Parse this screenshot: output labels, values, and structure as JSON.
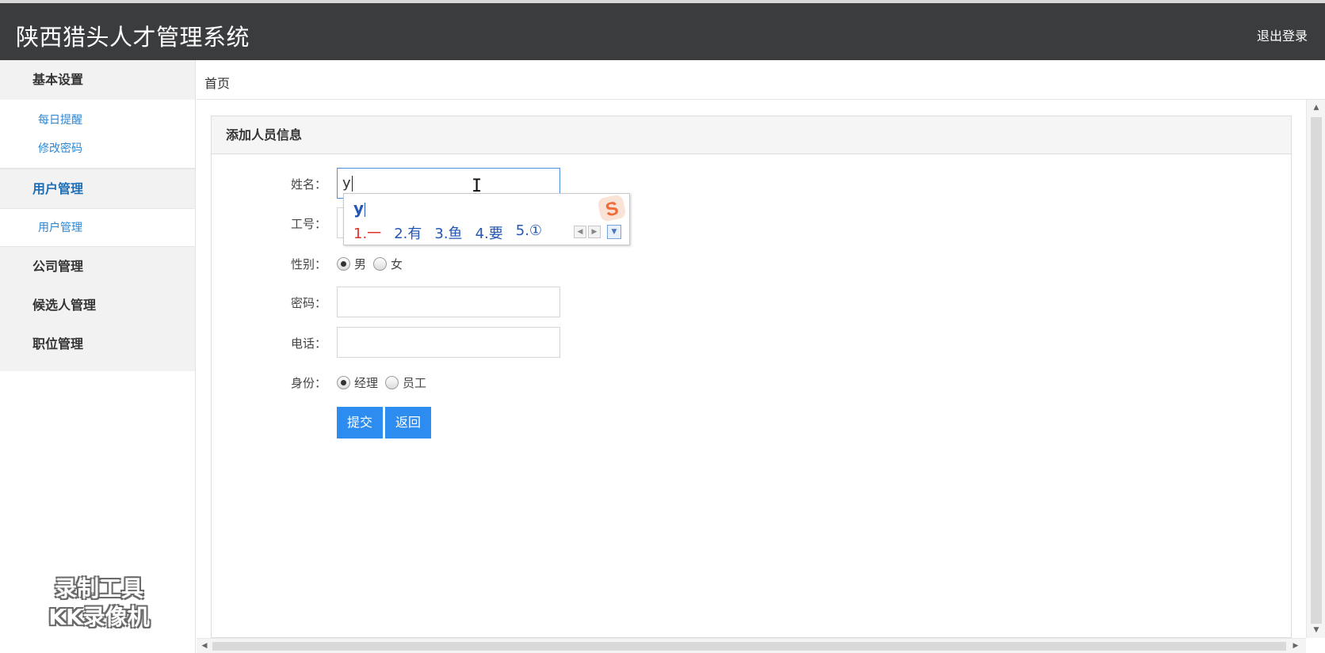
{
  "header": {
    "title": "陕西猎头人才管理系统",
    "logout": "退出登录"
  },
  "sidebar": {
    "groups": [
      {
        "label": "基本设置",
        "items": [
          "每日提醒",
          "修改密码"
        ]
      },
      {
        "label": "用户管理",
        "items": [
          "用户管理"
        ]
      },
      {
        "label": "公司管理",
        "items": []
      },
      {
        "label": "候选人管理",
        "items": []
      },
      {
        "label": "职位管理",
        "items": []
      }
    ]
  },
  "watermark": {
    "line1": "录制工具",
    "line2": "KK录像机"
  },
  "breadcrumb": "首页",
  "panel": {
    "title": "添加人员信息"
  },
  "form": {
    "name": {
      "label": "姓名：",
      "value": "y"
    },
    "job_no": {
      "label": "工号：",
      "value": ""
    },
    "gender": {
      "label": "性别：",
      "options": [
        "男",
        "女"
      ],
      "selected": "男"
    },
    "password": {
      "label": "密码：",
      "value": ""
    },
    "phone": {
      "label": "电话：",
      "value": ""
    },
    "identity": {
      "label": "身份：",
      "options": [
        "经理",
        "员工"
      ],
      "selected": "经理"
    },
    "submit": "提交",
    "back": "返回"
  },
  "ime": {
    "composition": "y",
    "candidates": [
      "1.一",
      "2.有",
      "3.鱼",
      "4.要",
      "5.①"
    ],
    "brand_color": "#f26b3a"
  },
  "colors": {
    "header_bg": "#3b3c3e",
    "accent": "#2d8cf0",
    "link": "#2d86d2"
  }
}
